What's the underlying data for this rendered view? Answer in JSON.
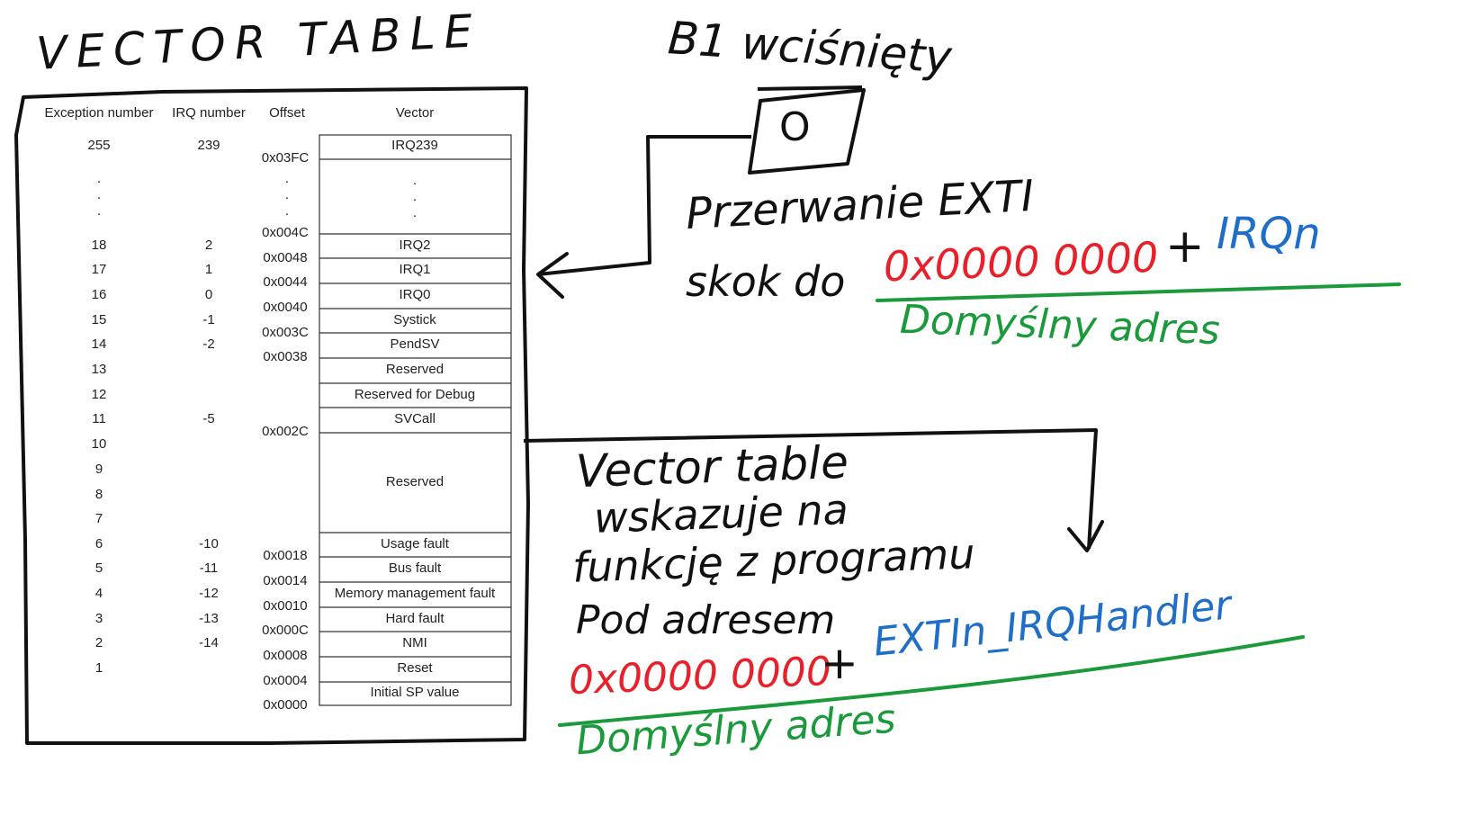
{
  "title": "VECTOR TABLE",
  "headers": {
    "exception": "Exception number",
    "irq": "IRQ number",
    "offset": "Offset",
    "vector": "Vector"
  },
  "exception_numbers": [
    "255",
    ".",
    ".",
    ".",
    "18",
    "17",
    "16",
    "15",
    "14",
    "13",
    "12",
    "11",
    "10",
    "9",
    "8",
    "7",
    "6",
    "5",
    "4",
    "3",
    "2",
    "1"
  ],
  "irq_numbers": [
    "239",
    "2",
    "1",
    "0",
    "-1",
    "-2",
    "-5",
    "-10",
    "-11",
    "-12",
    "-13",
    "-14"
  ],
  "offsets": [
    "0x03FC",
    ".",
    ".",
    ".",
    "0x004C",
    "0x0048",
    "0x0044",
    "0x0040",
    "0x003C",
    "0x0038",
    "0x002C",
    "0x0018",
    "0x0014",
    "0x0010",
    "0x000C",
    "0x0008",
    "0x0004",
    "0x0000"
  ],
  "vectors": [
    "IRQ239",
    ".",
    ".",
    ".",
    "IRQ2",
    "IRQ1",
    "IRQ0",
    "Systick",
    "PendSV",
    "Reserved",
    "Reserved for Debug",
    "SVCall",
    "Reserved",
    "Usage fault",
    "Bus fault",
    "Memory management fault",
    "Hard fault",
    "NMI",
    "Reset",
    "Initial SP value"
  ],
  "notes": {
    "button_caption": "B1 wciśnięty",
    "button_symbol": "O",
    "line1": "Przerwanie EXTI",
    "line2_a": "skok do",
    "line2_b": "0x0000 0000",
    "line2_c": "+",
    "line2_d": "IRQn",
    "line3": "Domyślny adres",
    "vt1": "Vector table",
    "vt2": "wskazuje na",
    "vt3": "funkcję z programu",
    "vt4": "Pod adresem",
    "vt5_a": "0x0000 0000",
    "vt5_b": "+",
    "vt5_c": "EXTIn_IRQHandler",
    "vt6": "Domyślny adres"
  },
  "colors": {
    "ink": "#111111",
    "red": "#e8202a",
    "blue": "#1f6fc9",
    "green": "#1a9a3a"
  }
}
